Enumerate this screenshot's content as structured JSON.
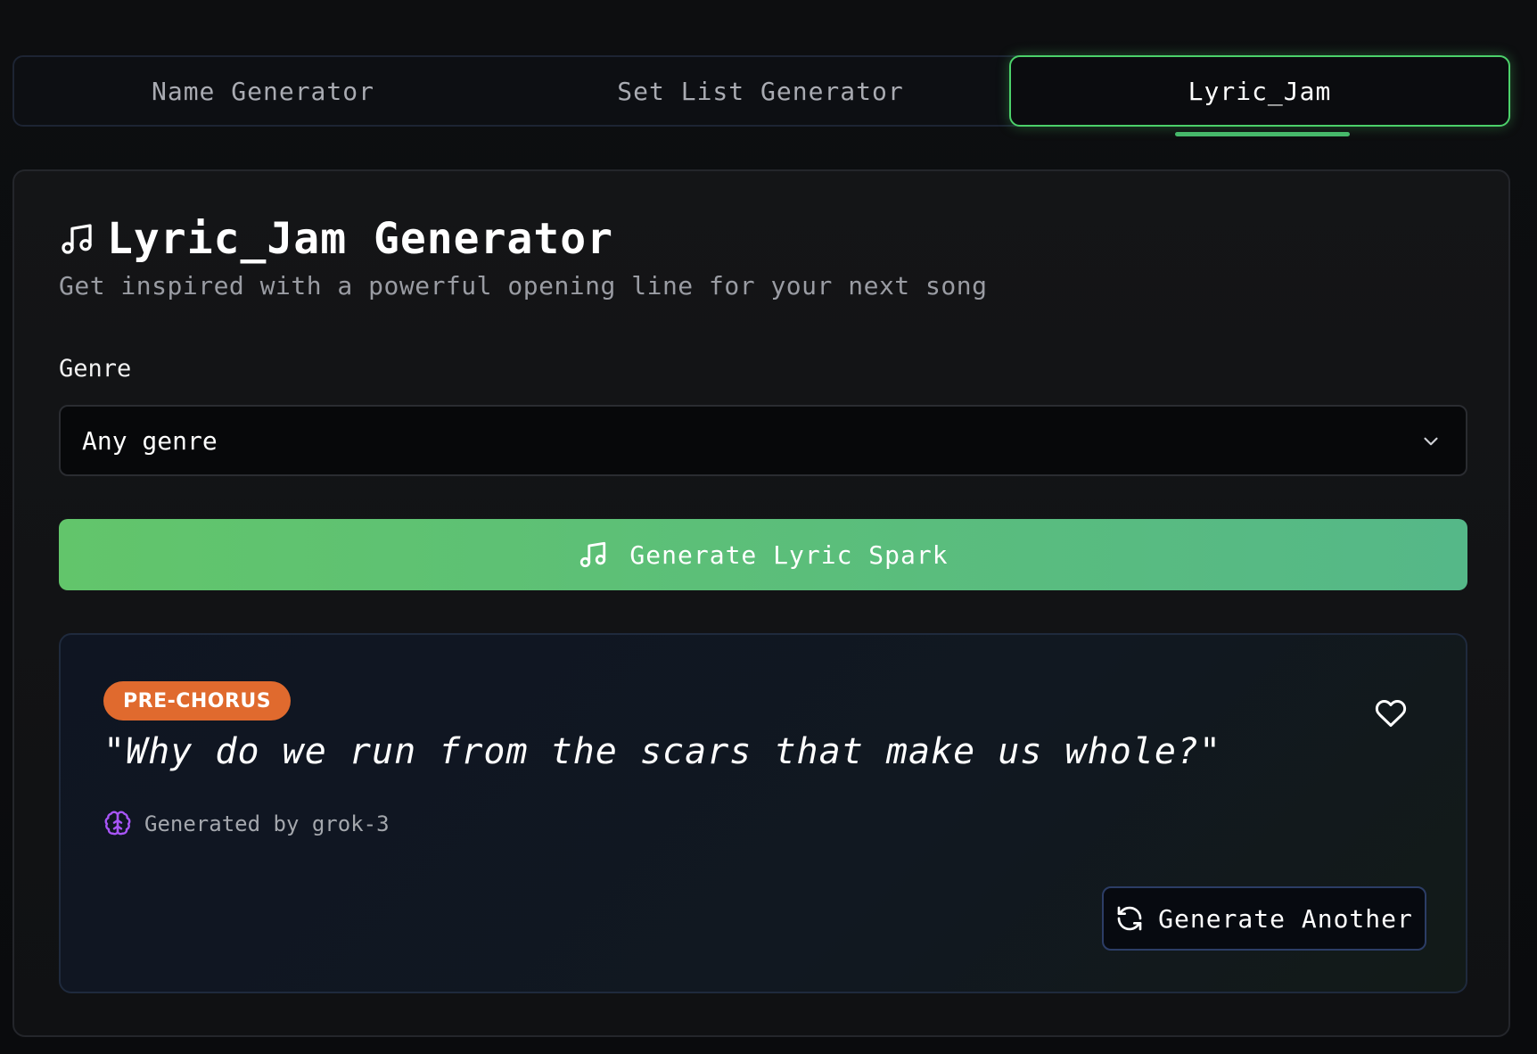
{
  "tabs": [
    {
      "label": "Name Generator",
      "active": false
    },
    {
      "label": "Set List Generator",
      "active": false
    },
    {
      "label": "Lyric_Jam",
      "active": true
    }
  ],
  "card": {
    "title": "Lyric_Jam Generator",
    "title_icon": "music-note-icon",
    "subtitle": "Get inspired with a powerful opening line for your next song"
  },
  "genre": {
    "label": "Genre",
    "selected": "Any genre",
    "icon": "chevron-down-icon"
  },
  "generate_button": {
    "label": "Generate Lyric Spark",
    "icon": "music-note-icon"
  },
  "result": {
    "badge": "PRE-CHORUS",
    "lyric": "\"Why do we run from the scars that make us whole?\"",
    "meta": "Generated by grok-3",
    "meta_icon": "brain-icon",
    "favorite_icon": "heart-icon",
    "another_button": "Generate Another",
    "another_icon": "refresh-icon"
  },
  "colors": {
    "accent_green": "#4cd16a",
    "button_gradient_start": "#62c56b",
    "button_gradient_end": "#55b888",
    "badge_orange": "#e06a2e",
    "brain_purple": "#a855f7",
    "background": "#0b0c0e"
  }
}
